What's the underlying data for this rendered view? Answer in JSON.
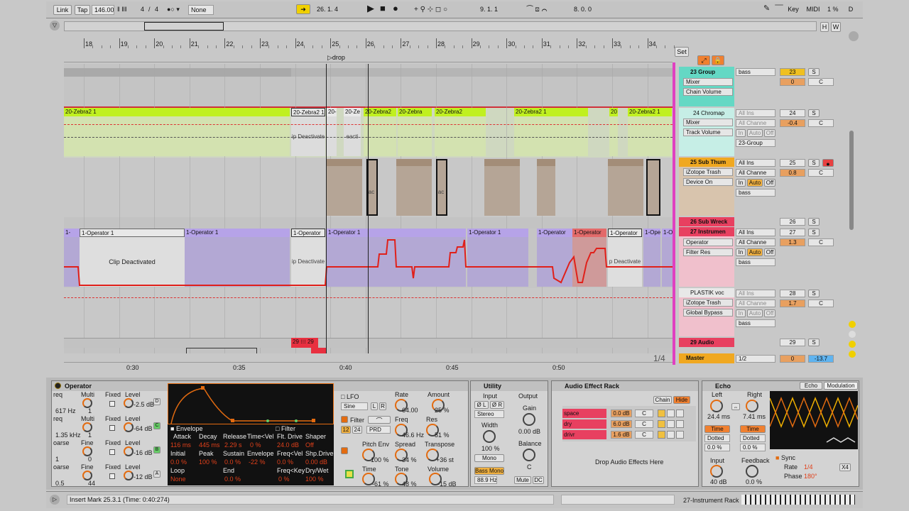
{
  "transport": {
    "link": "Link",
    "tap": "Tap",
    "tempo": "146.00",
    "sig_num": "4",
    "sig_den": "4",
    "groove": "None",
    "position": "26.  1.  4",
    "loop_start": "9.  1.  1",
    "loop_length": "8.  0.  0",
    "key": "Key",
    "midi": "MIDI",
    "cpu": "1 %",
    "d": "D"
  },
  "ruler": {
    "bars": [
      "18",
      "19",
      "20",
      "21",
      "22",
      "23",
      "24",
      "25",
      "26",
      "27",
      "28",
      "29",
      "30",
      "31",
      "32",
      "33",
      "34"
    ],
    "times": [
      "0:30",
      "0:35",
      "0:40",
      "0:45",
      "0:50"
    ],
    "locator": "drop",
    "zoom": "1/4"
  },
  "overview": {
    "h": "H",
    "w": "W"
  },
  "clips": {
    "zebra": [
      "20-Zebra2 1",
      "20-Zebra2 1",
      "20-",
      "20-Ze",
      "20-Zebra2",
      "20-Zebra",
      "20-Zebra2",
      "20-Zebra2 1",
      "20",
      "20-Zebra2 1"
    ],
    "zebra_deact": [
      "ip Deactivate",
      "eacti"
    ],
    "thumb_deact": [
      "ac",
      "ac"
    ],
    "operator": [
      "1-",
      "1-Operator 1",
      "1-Operator 1",
      "1-Operator",
      "1-Operator 1",
      "1-Operator 1",
      "1-Operator",
      "1-Operator",
      "1-Operator",
      "1-Ope",
      "1-O"
    ],
    "op_deact": [
      "Clip Deactivated",
      "ip Deactivate",
      "p Deactivate"
    ],
    "audio": [
      "29",
      "29"
    ]
  },
  "mixer": {
    "set": "Set",
    "tracks": [
      {
        "name": "23 Group",
        "dev1": "Mixer",
        "dev2": "Chain Volume",
        "input": "bass",
        "num": "23",
        "s": "S",
        "vol": "0",
        "pan": "C"
      },
      {
        "name": "24 Chromap",
        "dev1": "Mixer",
        "dev2": "Track Volume",
        "input": "All Ins",
        "chan": "All Channe",
        "mon_in": "In",
        "mon_auto": "Auto",
        "mon_off": "Off",
        "out": "23-Group",
        "num": "24",
        "s": "S",
        "vol": "-0.4",
        "pan": "C"
      },
      {
        "name": "25 Sub Thum",
        "dev1": "iZotope Trash",
        "dev2": "Device On",
        "input": "All Ins",
        "chan": "All Channe",
        "mon_in": "In",
        "mon_auto": "Auto",
        "mon_off": "Off",
        "out": "bass",
        "num": "25",
        "s": "S",
        "vol": "0.8",
        "pan": "C"
      },
      {
        "name": "26 Sub Wreck",
        "num": "26",
        "s": "S"
      },
      {
        "name": "27 Instrumen",
        "dev1": "Operator",
        "dev2": "Filter Res",
        "input": "All Ins",
        "chan": "All Channe",
        "mon_in": "In",
        "mon_auto": "Auto",
        "mon_off": "Off",
        "out": "bass",
        "num": "27",
        "s": "S",
        "vol": "1.3",
        "pan": "C"
      },
      {
        "name": "PLASTIK voc",
        "dev1": "iZotope Trash",
        "dev2": "Global Bypass",
        "input": "All Ins",
        "chan": "All Channe",
        "mon_in": "In",
        "mon_auto": "Auto",
        "mon_off": "Off",
        "out": "bass",
        "num": "28",
        "s": "S",
        "vol": "1.7",
        "pan": "C"
      },
      {
        "name": "29 Audio",
        "num": "29",
        "s": "S"
      },
      {
        "name": "Master",
        "input": "1/2",
        "num": "0",
        "vol": "-13.7"
      }
    ]
  },
  "operator": {
    "title": "Operator",
    "rows": [
      {
        "a": "req",
        "b": "Multi",
        "c": "Fixed",
        "d": "Level",
        "va": "617 Hz",
        "vb": "1",
        "vd": "-2.5 dB",
        "osc": "D"
      },
      {
        "a": "req",
        "b": "Multi",
        "c": "Fixed",
        "d": "Level",
        "va": "1.35 kHz",
        "vb": "1",
        "vd": "-64 dB",
        "osc": "C"
      },
      {
        "a": "oarse",
        "b": "Fine",
        "c": "Fixed",
        "d": "Level",
        "va": "1",
        "vb": "0",
        "vd": "-16 dB",
        "osc": "B"
      },
      {
        "a": "oarse",
        "b": "Fine",
        "c": "Fixed",
        "d": "Level",
        "va": "0.5",
        "vb": "44",
        "vd": "-12 dB",
        "osc": "A"
      }
    ],
    "env": {
      "label": "Envelope",
      "filter_label": "Filter",
      "attack": "Attack",
      "decay": "Decay",
      "release": "Release",
      "timevel": "Time<Vel",
      "shaper": "Shaper",
      "fltdrive": "Flt. Drive",
      "attack_v": "116 ms",
      "decay_v": "445 ms",
      "release_v": "2.29 s",
      "timevel_v": "0 %",
      "fltdrive_v": "24.0 dB",
      "shaper_v": "Off",
      "initial": "Initial",
      "peak": "Peak",
      "sustain": "Sustain",
      "envelope": "Envelope",
      "freqvel": "Freq<Vel",
      "shpdrive": "Shp.Drive",
      "initial_v": "0.0 %",
      "peak_v": "100 %",
      "sustain_v": "0.0 %",
      "envelope_v": "-22 %",
      "freqvel_v": "0.0 %",
      "shpdrive_v": "0.00 dB",
      "loop": "Loop",
      "end": "End",
      "freqkey": "Freq<Key",
      "drywet": "Dry/Wet",
      "loop_v": "None",
      "end_v": "0.0 %",
      "freqkey_v": "0 %",
      "drywet_v": "100 %"
    },
    "lfo": {
      "label": "LFO",
      "wave": "Sine",
      "rate": "Rate",
      "rate_v": "64.00",
      "amount": "Amount",
      "amount_v": "25 %",
      "filter": "Filter",
      "f12": "12",
      "f24": "24",
      "prd": "PRD",
      "freq": "Freq",
      "freq_v": "46.6 Hz",
      "res": "Res",
      "res_v": "51 %",
      "pitchenv": "Pitch Env",
      "pitchenv_v": "100 %",
      "spread": "Spread",
      "spread_v": "34 %",
      "transpose": "Transpose",
      "transpose_v": "+36 st",
      "time": "Time",
      "time_v": "-61 %",
      "tone": "Tone",
      "tone_v": "48 %",
      "volume": "Volume",
      "volume_v": "-15 dB",
      "l": "L",
      "r": "R"
    }
  },
  "utility": {
    "title": "Utility",
    "input": "Input",
    "output": "Output",
    "phase_l": "Ø L",
    "phase_r": "Ø R",
    "channel": "Stereo",
    "gain": "Gain",
    "gain_v": "0.00 dB",
    "width": "Width",
    "width_v": "100 %",
    "mono": "Mono",
    "balance": "Balance",
    "balance_v": "C",
    "bassmono": "Bass Mono",
    "bassmono_v": "88.9 Hz",
    "mute": "Mute",
    "dc": "DC"
  },
  "rack": {
    "title": "Audio Effect Rack",
    "chain": "Chain",
    "hide": "Hide",
    "chains": [
      {
        "name": "space",
        "vol": "0.0 dB",
        "pan": "C"
      },
      {
        "name": "dry",
        "vol": "6.0 dB",
        "pan": "C"
      },
      {
        "name": "drivr",
        "vol": "1.6 dB",
        "pan": "C"
      }
    ],
    "drop": "Drop Audio Effects Here"
  },
  "echo": {
    "title": "Echo",
    "tab1": "Echo",
    "tab2": "Modulation",
    "left": "Left",
    "right": "Right",
    "left_v": "24.4 ms",
    "right_v": "7.41 ms",
    "time": "Time",
    "dotted": "Dotted",
    "pct": "0.0 %",
    "input": "Input",
    "input_v": "40 dB",
    "feedback": "Feedback",
    "feedback_v": "0.0 %",
    "sync": "Sync",
    "rate": "Rate",
    "rate_v": "1/4",
    "phase": "Phase",
    "phase_v": "180°",
    "x4": "X4"
  },
  "status": {
    "info": "Insert Mark 25.3.1 (Time: 0:40:274)",
    "track": "27-Instrument Rack"
  }
}
